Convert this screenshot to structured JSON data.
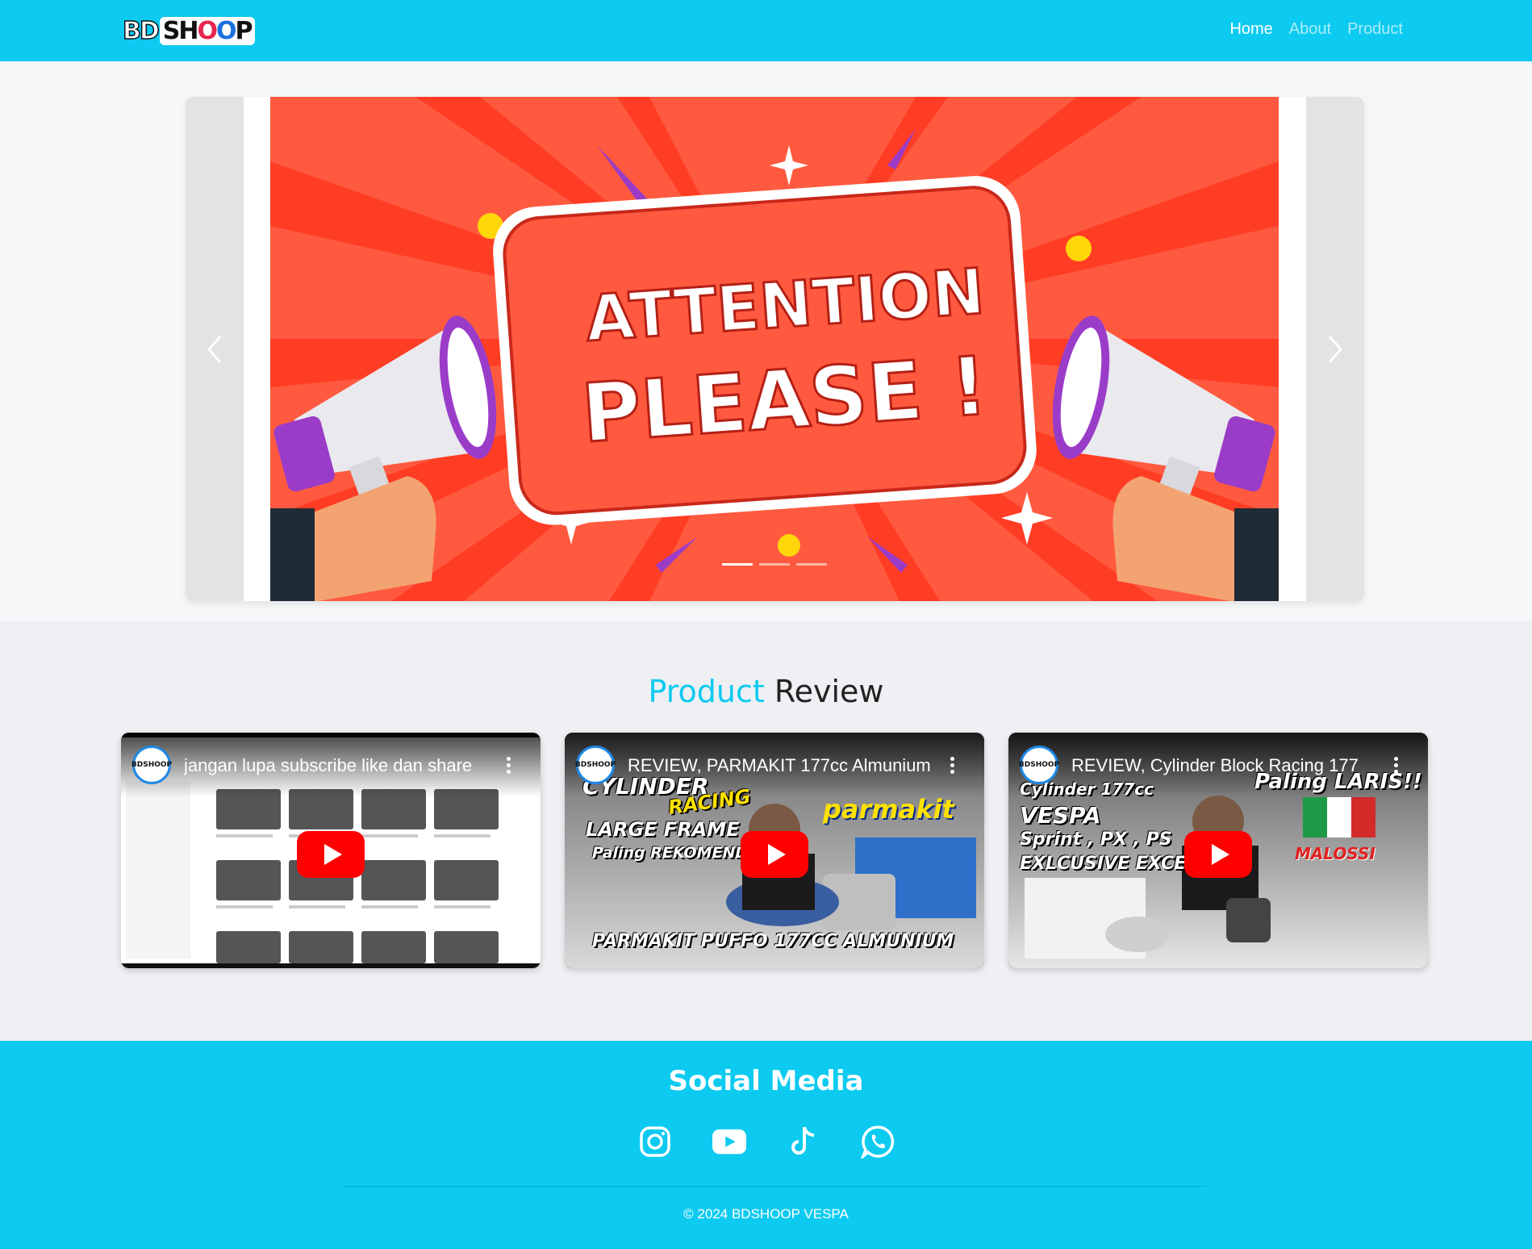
{
  "brand": {
    "logo_left": "BD",
    "logo_right": "SHOOP"
  },
  "nav": {
    "items": [
      {
        "label": "Home"
      },
      {
        "label": "About"
      },
      {
        "label": "Product"
      }
    ]
  },
  "hero": {
    "banner_line1": "ATTENTION",
    "banner_line2": "PLEASE !",
    "slide_count": 3,
    "active_slide": 1
  },
  "review": {
    "heading_highlight": "Product",
    "heading_rest": "Review",
    "videos": [
      {
        "title": "jangan lupa subscribe like dan share",
        "channel_badge": "BDSHOOP"
      },
      {
        "title": "REVIEW, PARMAKIT 177cc Almunium",
        "channel_badge": "BDSHOOP",
        "overlay": [
          "CYLINDER",
          "RACING",
          "LARGE FRAME",
          "Paling REKOMENDA",
          "parmakit",
          "PARMAKIT PUFFO 177CC ALMUNIUM"
        ]
      },
      {
        "title": "REVIEW, Cylinder Block Racing 177",
        "channel_badge": "BDSHOOP",
        "overlay": [
          "Cylinder 177cc",
          "VESPA",
          "Sprint , PX , PS",
          "EXLCUSIVE EXCEL",
          "Paling LARIS!!",
          "MALOSSI"
        ]
      }
    ]
  },
  "footer": {
    "title": "Social Media",
    "icons": [
      "instagram-icon",
      "youtube-icon",
      "tiktok-icon",
      "whatsapp-icon"
    ],
    "copyright": "© 2024 BDSHOOP VESPA"
  },
  "colors": {
    "primary": "#0dcaf0",
    "banner_bg": "#ff5a3f",
    "youtube_red": "#ff0000"
  }
}
